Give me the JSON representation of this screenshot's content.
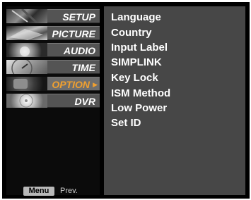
{
  "menu": {
    "items": [
      {
        "label": "SETUP",
        "icon": "setup-thumbnail-icon",
        "selected": false
      },
      {
        "label": "PICTURE",
        "icon": "picture-thumbnail-icon",
        "selected": false
      },
      {
        "label": "AUDIO",
        "icon": "audio-thumbnail-icon",
        "selected": false
      },
      {
        "label": "TIME",
        "icon": "time-thumbnail-icon",
        "selected": false
      },
      {
        "label": "OPTION",
        "icon": "option-thumbnail-icon",
        "selected": true
      },
      {
        "label": "DVR",
        "icon": "dvr-thumbnail-icon",
        "selected": false
      }
    ],
    "selected_color": "#f0a030"
  },
  "footer": {
    "key_label": "Menu",
    "action_label": "Prev."
  },
  "option_menu": {
    "items": [
      "Language",
      "Country",
      "Input Label",
      "SIMPLINK",
      "Key Lock",
      "ISM Method",
      "Low Power",
      "Set ID"
    ]
  }
}
